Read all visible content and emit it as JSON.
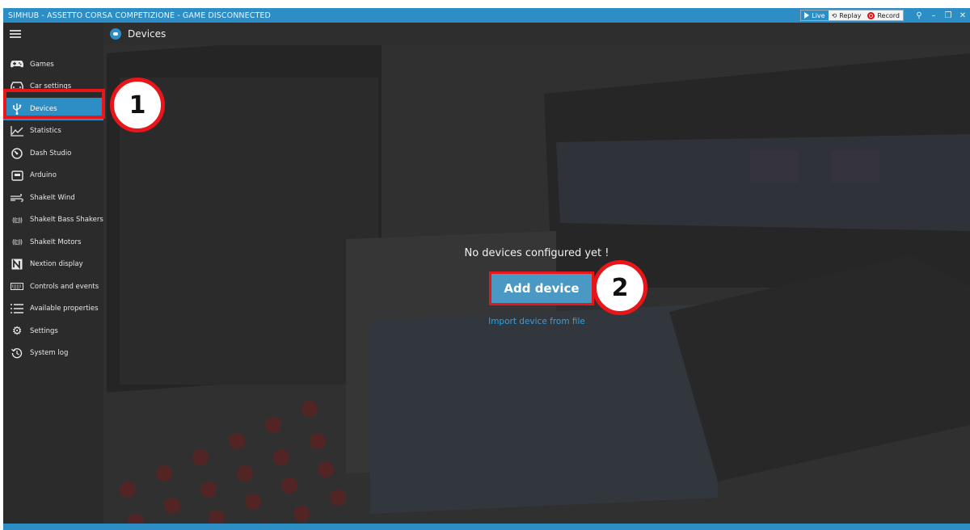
{
  "window": {
    "title": "SIMHUB - ASSETTO CORSA COMPETIZIONE - GAME DISCONNECTED",
    "live_label": "Live",
    "replay_label": "Replay",
    "record_label": "Record",
    "accent_color": "#2d8dc5"
  },
  "header": {
    "title": "Devices",
    "icon": "gamepad-icon"
  },
  "sidebar": {
    "items": [
      {
        "label": "Games",
        "icon": "gamepad-icon"
      },
      {
        "label": "Car settings",
        "icon": "car-icon"
      },
      {
        "label": "Devices",
        "icon": "usb-icon",
        "active": true
      },
      {
        "label": "Statistics",
        "icon": "line-chart-icon"
      },
      {
        "label": "Dash Studio",
        "icon": "gauge-icon"
      },
      {
        "label": "Arduino",
        "icon": "board-icon"
      },
      {
        "label": "ShakeIt Wind",
        "icon": "wind-icon"
      },
      {
        "label": "ShakeIt Bass Shakers",
        "icon": "vibration-icon"
      },
      {
        "label": "ShakeIt Motors",
        "icon": "vibration-icon"
      },
      {
        "label": "Nextion display",
        "icon": "nextion-icon"
      },
      {
        "label": "Controls and events",
        "icon": "keyboard-icon"
      },
      {
        "label": "Available properties",
        "icon": "list-icon"
      },
      {
        "label": "Settings",
        "icon": "gear-icon"
      },
      {
        "label": "System log",
        "icon": "history-icon"
      }
    ]
  },
  "main": {
    "empty_message": "No devices configured yet !",
    "add_button": "Add device",
    "import_link": "Import device from file"
  },
  "annotations": {
    "step1": "1",
    "step2": "2"
  }
}
